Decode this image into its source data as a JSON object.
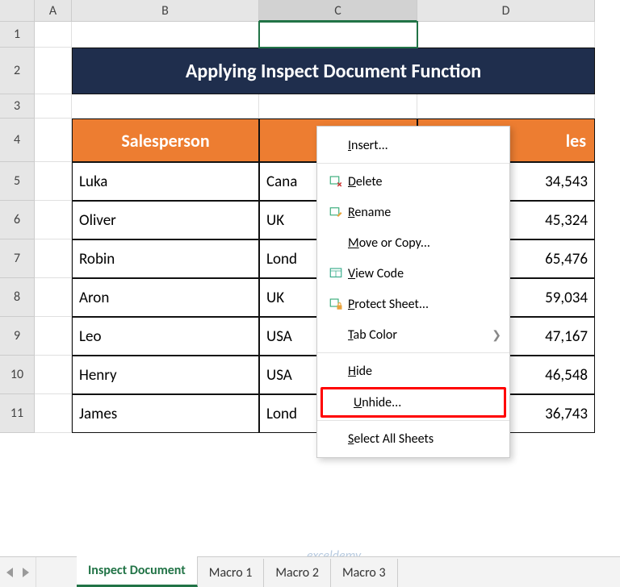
{
  "columns": [
    "A",
    "B",
    "C",
    "D"
  ],
  "active_column": "C",
  "rows": [
    1,
    2,
    3,
    4,
    5,
    6,
    7,
    8,
    9,
    10,
    11
  ],
  "title": "Applying Inspect Document Function",
  "table": {
    "headers": [
      "Salesperson",
      "",
      "les"
    ],
    "header_visible_right": "les",
    "data": [
      {
        "name": "Luka",
        "country": "Cana",
        "value": "34,543"
      },
      {
        "name": "Oliver",
        "country": "UK",
        "value": "45,324"
      },
      {
        "name": "Robin",
        "country": "Lond",
        "value": "65,476"
      },
      {
        "name": "Aron",
        "country": "UK",
        "value": "59,034"
      },
      {
        "name": "Leo",
        "country": "USA",
        "value": "47,167"
      },
      {
        "name": "Henry",
        "country": "USA",
        "value": "46,548"
      },
      {
        "name": "James",
        "country": "Lond",
        "value": "36,743"
      }
    ]
  },
  "context_menu": {
    "items": [
      {
        "label_pre": "",
        "u": "I",
        "label_post": "nsert...",
        "icon": null
      },
      {
        "label_pre": "",
        "u": "D",
        "label_post": "elete",
        "icon": "delete"
      },
      {
        "label_pre": "",
        "u": "R",
        "label_post": "ename",
        "icon": "rename"
      },
      {
        "label_pre": "",
        "u": "M",
        "label_post": "ove or Copy...",
        "icon": null
      },
      {
        "label_pre": "",
        "u": "V",
        "label_post": "iew Code",
        "icon": "viewcode"
      },
      {
        "label_pre": "",
        "u": "P",
        "label_post": "rotect Sheet...",
        "icon": "protect"
      },
      {
        "label_pre": "",
        "u": "T",
        "label_post": "ab Color",
        "icon": null,
        "submenu": true
      },
      {
        "label_pre": "",
        "u": "H",
        "label_post": "ide",
        "icon": null
      },
      {
        "label_pre": "",
        "u": "U",
        "label_post": "nhide...",
        "icon": null,
        "highlight": true
      },
      {
        "label_pre": "",
        "u": "S",
        "label_post": "elect All Sheets",
        "icon": null
      }
    ]
  },
  "tabs": [
    "Inspect Document",
    "Macro 1",
    "Macro 2",
    "Macro 3"
  ],
  "active_tab": 0,
  "watermark": "exceldemy"
}
